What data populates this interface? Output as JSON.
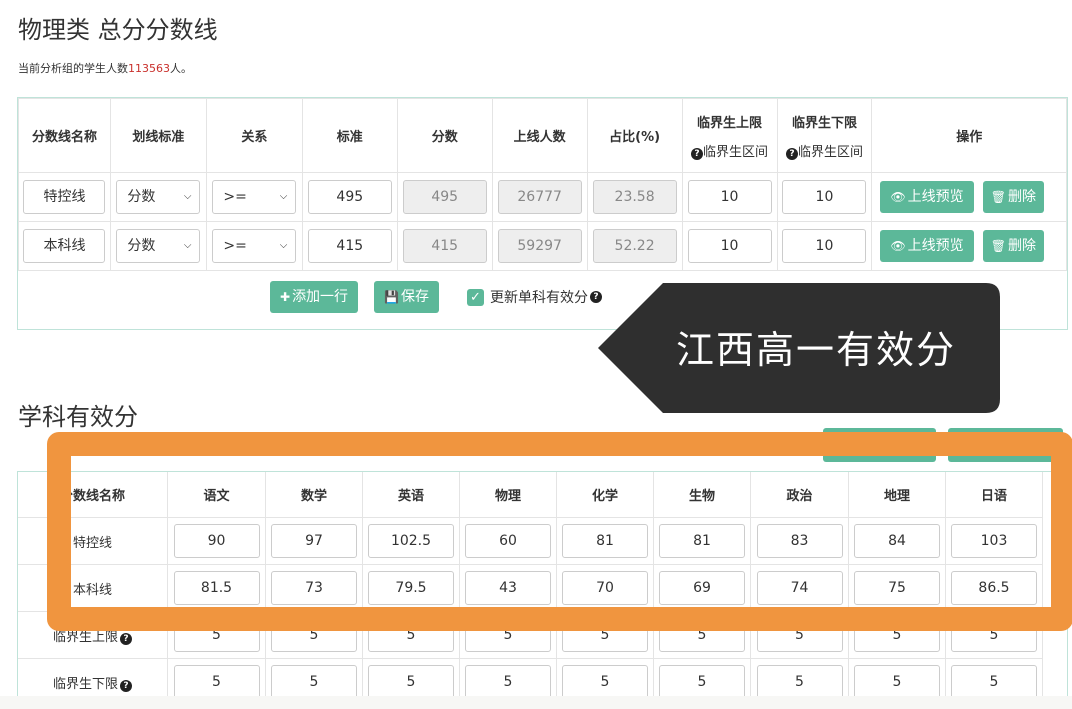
{
  "page": {
    "title": "物理类 总分分数线",
    "subtitle_prefix": "当前分析组的学生人数",
    "student_count": "113563",
    "subtitle_suffix": "人。"
  },
  "score_table": {
    "headers": {
      "name": "分数线名称",
      "standard_type": "划线标准",
      "relation": "关系",
      "standard": "标准",
      "score": "分数",
      "count": "上线人数",
      "ratio": "占比(%)",
      "upper": "临界生上限",
      "upper_sub": "临界生区间",
      "lower": "临界生下限",
      "lower_sub": "临界生区间",
      "action": "操作"
    },
    "rows": [
      {
        "name": "特控线",
        "standard_type": "分数",
        "relation": ">=",
        "standard": "495",
        "score": "495",
        "count": "26777",
        "ratio": "23.58",
        "upper": "10",
        "lower": "10",
        "preview": "上线预览",
        "delete": "删除"
      },
      {
        "name": "本科线",
        "standard_type": "分数",
        "relation": ">=",
        "standard": "415",
        "score": "415",
        "count": "59297",
        "ratio": "52.22",
        "upper": "10",
        "lower": "10",
        "preview": "上线预览",
        "delete": "删除"
      }
    ],
    "add_row": "添加一行",
    "save": "保存",
    "update_checkbox": "更新单科有效分"
  },
  "callout": "江西高一有效分",
  "subject_section": {
    "title": "学科有效分",
    "header_name": "分数线名称",
    "subjects": [
      "语文",
      "数学",
      "英语",
      "物理",
      "化学",
      "生物",
      "政治",
      "地理",
      "日语"
    ],
    "rows": [
      {
        "label": "特控线",
        "values": [
          "90",
          "97",
          "102.5",
          "60",
          "81",
          "81",
          "83",
          "84",
          "103"
        ]
      },
      {
        "label": "本科线",
        "values": [
          "81.5",
          "73",
          "79.5",
          "43",
          "70",
          "69",
          "74",
          "75",
          "86.5"
        ]
      },
      {
        "label": "临界生上限",
        "values": [
          "5",
          "5",
          "5",
          "5",
          "5",
          "5",
          "5",
          "5",
          "5"
        ]
      },
      {
        "label": "临界生下限",
        "values": [
          "5",
          "5",
          "5",
          "5",
          "5",
          "5",
          "5",
          "5",
          "5"
        ]
      }
    ]
  },
  "colors": {
    "accent_green": "#5cb899",
    "count_red": "#c9302c",
    "highlight_orange": "#f0953f",
    "callout_dark": "#2f2f2f"
  }
}
